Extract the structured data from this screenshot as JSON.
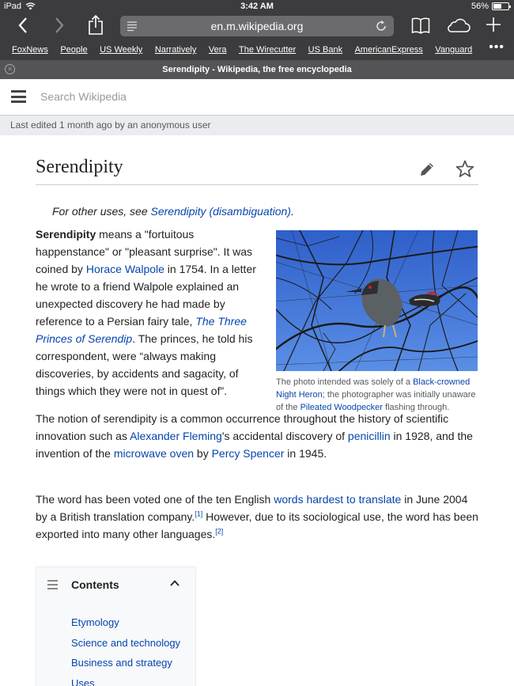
{
  "status": {
    "device": "iPad",
    "time": "3:42 AM",
    "battery": "56%",
    "battery_level": 0.56
  },
  "browser": {
    "url": "en.m.wikipedia.org",
    "tab_title": "Serendipity - Wikipedia, the free encyclopedia"
  },
  "favorites": [
    "FoxNews",
    "People",
    "US Weekly",
    "Narratively",
    "Vera",
    "The Wirecutter",
    "US Bank",
    "AmericanExpress",
    "Vanguard"
  ],
  "favorites_more": "•••",
  "wiki": {
    "search_placeholder": "Search Wikipedia",
    "last_edited": "Last edited 1 month ago by an anonymous user"
  },
  "article": {
    "title": "Serendipity",
    "hatnote": {
      "prefix": "For other uses, see ",
      "link": "Serendipity (disambiguation)",
      "suffix": "."
    },
    "para1": {
      "bold": "Serendipity",
      "t1": " means a \"fortuitous happenstance\" or \"pleasant surprise\". It was coined by ",
      "link1": "Horace Walpole",
      "t2": " in 1754. In a letter he wrote to a friend Walpole explained an unexpected discovery he had made by reference to a Persian fairy tale, ",
      "link2": "The Three Princes of Serendip",
      "t3": ". The princes, he told his correspondent, were “always making discoveries, by accidents and sagacity, of things which they were not in quest of”."
    },
    "image_caption": {
      "t1": "The photo intended was solely of a ",
      "link1": "Black-crowned Night Heron",
      "t2": "; the photographer was initially unaware of the ",
      "link2": "Pileated Woodpecker",
      "t3": " flashing through."
    },
    "para2": {
      "t1": "The notion of serendipity is a common occurrence throughout the history of scientific innovation such as ",
      "link1": "Alexander Fleming",
      "t2": "'s accidental discovery of ",
      "link2": "penicillin",
      "t3": " in 1928, and the invention of the ",
      "link3": "microwave oven",
      "t4": " by ",
      "link4": "Percy Spencer",
      "t5": " in 1945."
    },
    "para3": {
      "t1": "The word has been voted one of the ten English ",
      "link1": "words hardest to translate",
      "t2": " in June 2004 by a British translation company.",
      "ref1": "[1]",
      "t3": " However, due to its sociological use, the word has been exported into many other languages.",
      "ref2": "[2]"
    }
  },
  "toc": {
    "title": "Contents",
    "items": [
      "Etymology",
      "Science and technology",
      "Business and strategy",
      "Uses"
    ]
  },
  "colors": {
    "link": "#0645ad",
    "chrome": "#3c3c3e",
    "sky": "#3f6fd6"
  }
}
